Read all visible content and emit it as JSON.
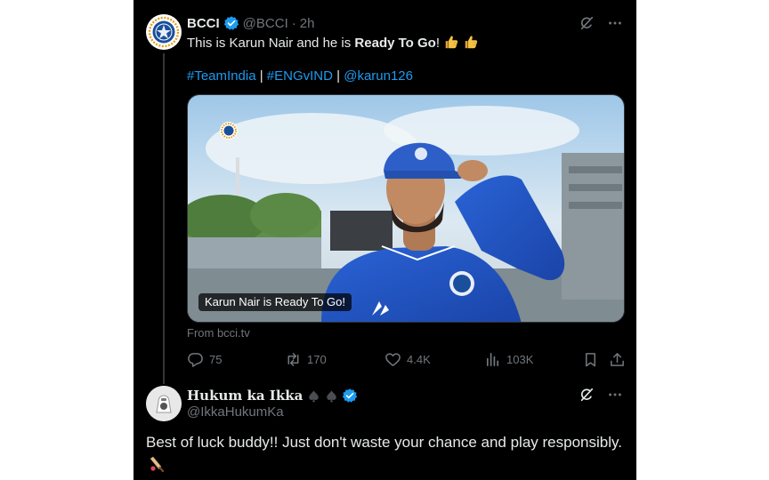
{
  "post": {
    "author_name": "BCCI",
    "handle": "@BCCI",
    "dot": "·",
    "time": "2h",
    "text_prefix": "This is Karun Nair and he is ",
    "text_bold": "Ready To Go",
    "text_suffix": "!",
    "hashtag_1": "#TeamIndia",
    "separator_1": " | ",
    "hashtag_2": "#ENGvIND",
    "separator_2": " | ",
    "mention": "@karun126",
    "media_caption": "Karun Nair is Ready To Go!",
    "source": "From bcci.tv",
    "actions": {
      "replies": "75",
      "reposts": "170",
      "likes": "4.4K",
      "views": "103K"
    }
  },
  "reply": {
    "author_name": "Hukum ka Ikka",
    "handle": "@IkkaHukumKa",
    "text": "Best of luck buddy!! Just don't waste your chance and play responsibly."
  },
  "colors": {
    "background": "#000000",
    "text_primary": "#e7e9ea",
    "text_secondary": "#71767b",
    "link": "#1d9bf0",
    "verified": "#1d9bf0"
  },
  "icons": [
    "bcci-logo-icon",
    "verified-badge-icon",
    "grok-icon",
    "more-icon",
    "thumbs-up-icon",
    "reply-icon",
    "repost-icon",
    "like-icon",
    "views-icon",
    "bookmark-icon",
    "share-icon",
    "spade-icon",
    "cricket-bat-icon"
  ]
}
